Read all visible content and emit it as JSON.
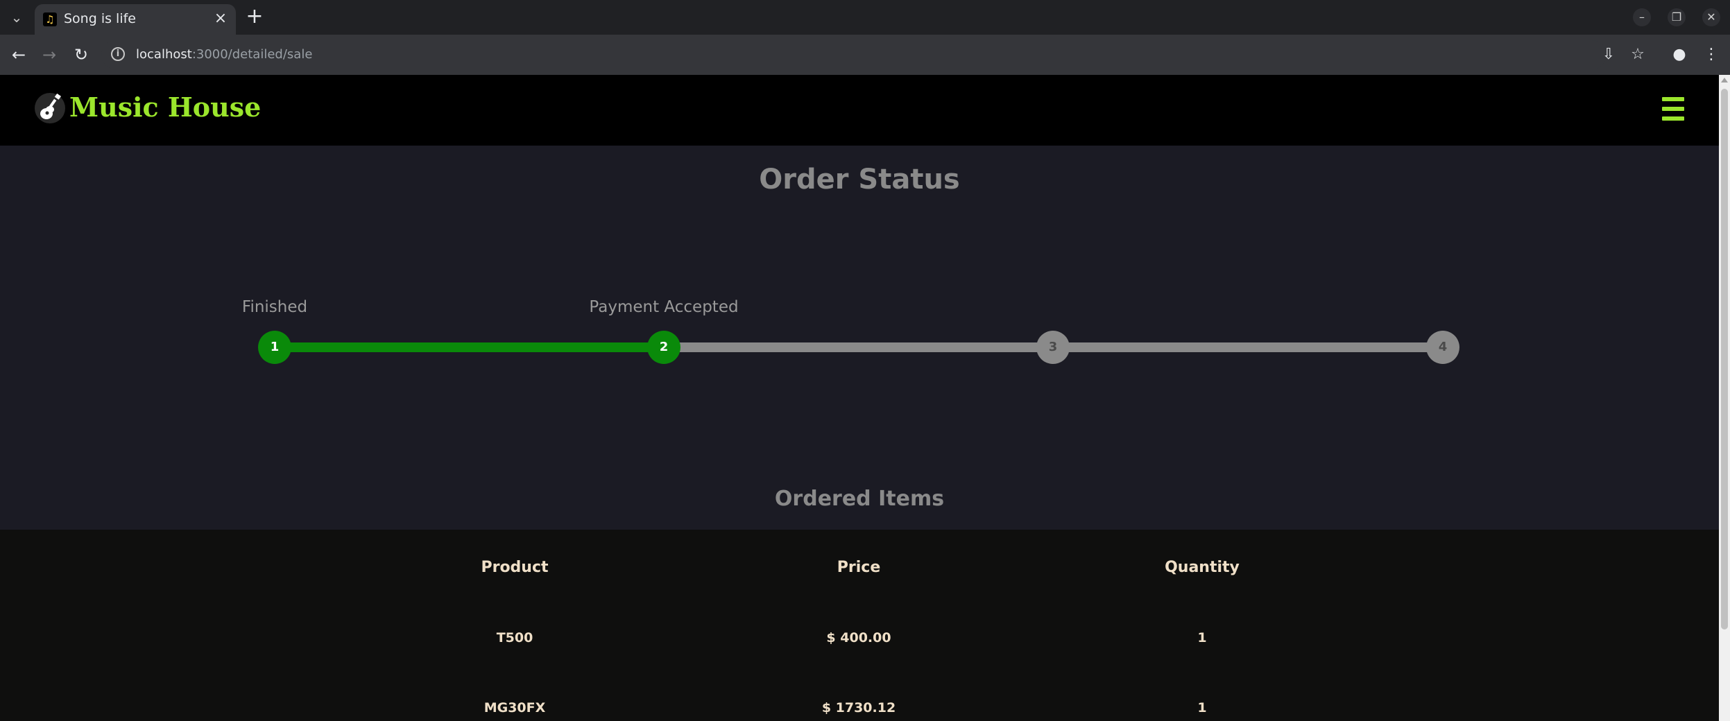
{
  "browser": {
    "tab_title": "Song is life",
    "url_host": "localhost",
    "url_path": ":3000/detailed/sale"
  },
  "site": {
    "logo_text": "Music House"
  },
  "order_status": {
    "title": "Order Status",
    "current_step": 2,
    "steps": [
      {
        "number": "1",
        "label": "Finished",
        "completed": true
      },
      {
        "number": "2",
        "label": "Payment Accepted",
        "completed": true
      },
      {
        "number": "3",
        "label": "",
        "completed": false
      },
      {
        "number": "4",
        "label": "",
        "completed": false
      }
    ]
  },
  "ordered_items": {
    "title": "Ordered Items",
    "columns": [
      "Product",
      "Price",
      "Quantity"
    ],
    "rows": [
      {
        "product": "T500",
        "price": "$ 400.00",
        "quantity": "1"
      },
      {
        "product": "MG30FX",
        "price": "$ 1730.12",
        "quantity": "1"
      }
    ]
  },
  "colors": {
    "accent": "#9be62c",
    "step_done": "#0a8a0a",
    "step_todo": "#8a8a8a",
    "page_bg": "#1b1b24",
    "table_bg": "#0f0f0e"
  }
}
